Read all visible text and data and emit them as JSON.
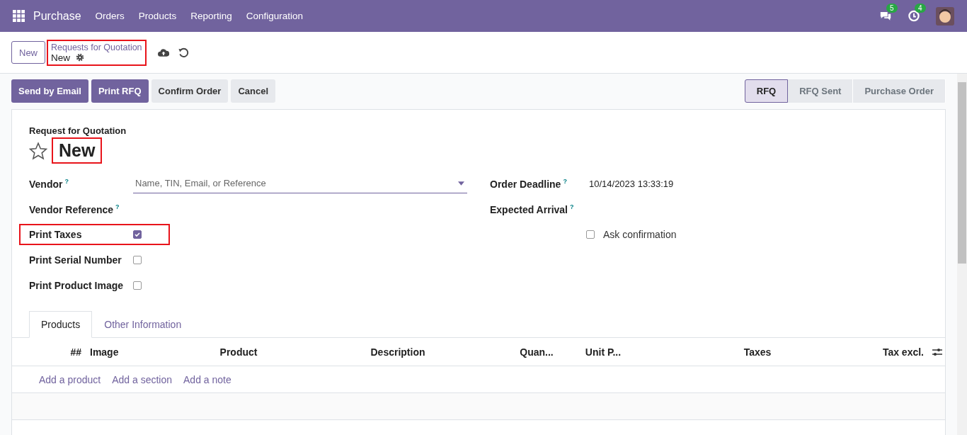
{
  "navbar": {
    "app_name": "Purchase",
    "menu": [
      "Orders",
      "Products",
      "Reporting",
      "Configuration"
    ],
    "messages_count": "5",
    "activities_count": "4"
  },
  "control_panel": {
    "new_button": "New",
    "breadcrumb": "Requests for Quotation",
    "record": "New",
    "highlighted": true
  },
  "action_buttons": [
    {
      "label": "Send by Email",
      "kind": "primary"
    },
    {
      "label": "Print RFQ",
      "kind": "primary"
    },
    {
      "label": "Confirm Order",
      "kind": "secondary"
    },
    {
      "label": "Cancel",
      "kind": "secondary"
    }
  ],
  "status_steps": [
    {
      "label": "RFQ",
      "selected": true
    },
    {
      "label": "RFQ Sent",
      "selected": false
    },
    {
      "label": "Purchase Order",
      "selected": false
    }
  ],
  "form": {
    "subtitle": "Request for Quotation",
    "title": "New",
    "title_highlighted": true,
    "starred": false,
    "left_fields": [
      {
        "kind": "select",
        "label": "Vendor",
        "help": "?",
        "placeholder": "Name, TIN, Email, or Reference"
      },
      {
        "kind": "text",
        "label": "Vendor Reference",
        "help": "?"
      },
      {
        "kind": "checkbox",
        "label": "Print Taxes",
        "checked": true,
        "highlighted": true
      },
      {
        "kind": "checkbox",
        "label": "Print Serial Number",
        "checked": false,
        "highlighted": false
      },
      {
        "kind": "checkbox",
        "label": "Print Product Image",
        "checked": false,
        "highlighted": false
      }
    ],
    "right_fields": [
      {
        "kind": "text",
        "label": "Order Deadline",
        "help": "?",
        "value": "10/14/2023 13:33:19"
      },
      {
        "kind": "text",
        "label": "Expected Arrival",
        "help": "?"
      },
      {
        "kind": "inline_checkbox",
        "label": "Ask confirmation",
        "checked": false
      }
    ]
  },
  "tabs": [
    {
      "label": "Products",
      "selected": true
    },
    {
      "label": "Other Information",
      "selected": false
    }
  ],
  "table": {
    "columns": [
      "##",
      "Image",
      "Product",
      "Description",
      "Quan...",
      "Unit P...",
      "Taxes",
      "Tax excl."
    ],
    "add_links": [
      "Add a product",
      "Add a section",
      "Add a note"
    ]
  }
}
